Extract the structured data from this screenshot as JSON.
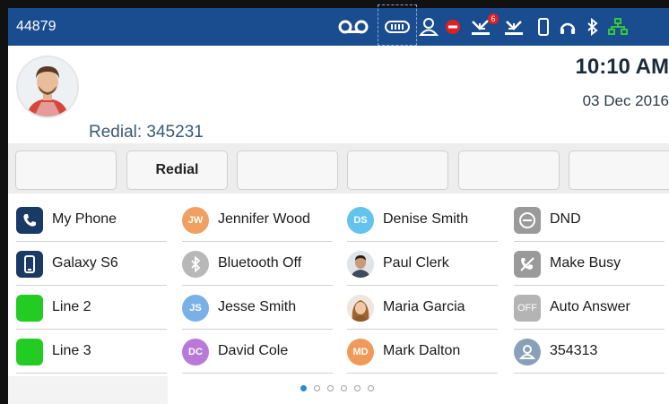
{
  "status_bar": {
    "extension": "44879",
    "voicemail_badge": "6",
    "icons": [
      "voicemail-icon",
      "keyboard-icon",
      "presence-icon",
      "dnd-icon",
      "missed-calls-icon",
      "call-forward-icon",
      "mobile-icon",
      "headset-icon",
      "bluetooth-icon",
      "network-icon"
    ],
    "bg_color": "#1a4c90"
  },
  "header": {
    "redial_info": "Redial: 345231",
    "time": "10:10 AM",
    "date": "03 Dec 2016"
  },
  "softkeys": [
    "",
    "Redial",
    "",
    "",
    "",
    ""
  ],
  "grid": {
    "col1": [
      {
        "label": "My Phone",
        "icon": "phone-icon"
      },
      {
        "label": "Galaxy S6",
        "icon": "mobile-icon"
      },
      {
        "label": "Line 2",
        "icon": "line-status-icon"
      },
      {
        "label": "Line 3",
        "icon": "line-status-icon"
      }
    ],
    "col2": [
      {
        "label": "Jennifer Wood",
        "initials": "JW",
        "color": "#f0a060"
      },
      {
        "label": "Bluetooth Off",
        "icon": "bluetooth-icon"
      },
      {
        "label": "Jesse Smith",
        "initials": "JS",
        "color": "#7ab0e8"
      },
      {
        "label": "David Cole",
        "initials": "DC",
        "color": "#b77ad8"
      }
    ],
    "col3": [
      {
        "label": "Denise Smith",
        "initials": "DS",
        "color": "#62c4ea"
      },
      {
        "label": "Paul Clerk",
        "icon": "contact-photo"
      },
      {
        "label": "Maria Garcia",
        "icon": "contact-photo"
      },
      {
        "label": "Mark Dalton",
        "initials": "MD",
        "color": "#f09a5a"
      }
    ],
    "col4": [
      {
        "label": "DND",
        "icon": "dnd-icon"
      },
      {
        "label": "Make Busy",
        "icon": "make-busy-icon"
      },
      {
        "label": "Auto Answer",
        "icon": "auto-answer-icon",
        "badge_text": "OFF"
      },
      {
        "label": "354313",
        "icon": "presence-icon"
      }
    ]
  },
  "pagination": {
    "pages": 6,
    "current": 1
  },
  "colors": {
    "accent": "#1a4c90",
    "line_ok": "#22cc22",
    "dnd_red": "#e02020"
  }
}
